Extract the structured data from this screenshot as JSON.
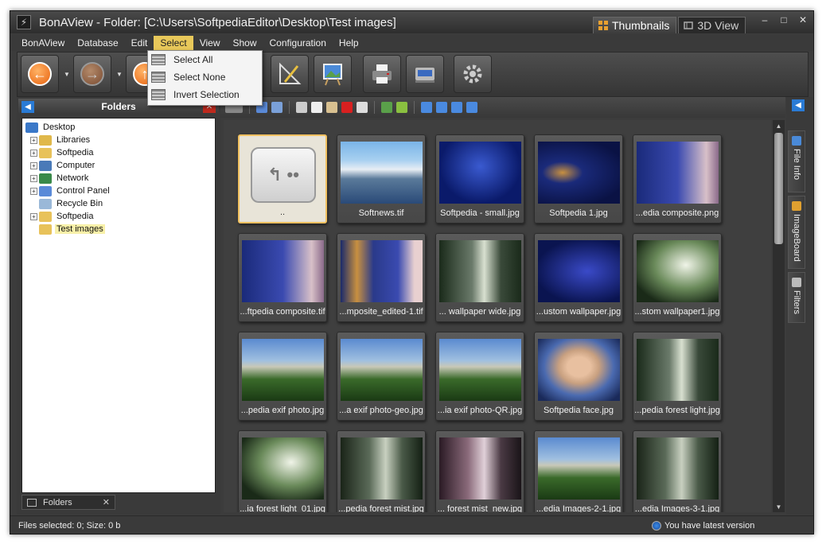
{
  "window": {
    "title": "BonAView - Folder: [C:\\Users\\SoftpediaEditor\\Desktop\\Test images]",
    "view_tabs": [
      {
        "label": "Thumbnails",
        "icon": "grid-icon",
        "active": true
      },
      {
        "label": "3D View",
        "icon": "3d-view-icon",
        "active": false
      }
    ],
    "controls": {
      "minimize": "–",
      "maximize": "□",
      "close": "✕"
    }
  },
  "menu": {
    "items": [
      "BonAView",
      "Database",
      "Edit",
      "Select",
      "View",
      "Show",
      "Configuration",
      "Help"
    ],
    "open_index": 3
  },
  "select_menu": {
    "items": [
      "Select All",
      "Select None",
      "Invert Selection"
    ]
  },
  "folders_panel": {
    "title": "Folders",
    "tree": [
      {
        "label": "Desktop",
        "icon": "desktop-icon",
        "color": "#3a78c8",
        "expander": "",
        "indent": 0
      },
      {
        "label": "Libraries",
        "icon": "libraries-icon",
        "color": "#e0b84a",
        "expander": "+",
        "indent": 1
      },
      {
        "label": "Softpedia",
        "icon": "folder-icon",
        "color": "#e8c25a",
        "expander": "+",
        "indent": 1
      },
      {
        "label": "Computer",
        "icon": "computer-icon",
        "color": "#4a7ab8",
        "expander": "+",
        "indent": 1
      },
      {
        "label": "Network",
        "icon": "network-icon",
        "color": "#3a8a4a",
        "expander": "+",
        "indent": 1
      },
      {
        "label": "Control Panel",
        "icon": "control-panel-icon",
        "color": "#5a8ad8",
        "expander": "+",
        "indent": 1
      },
      {
        "label": "Recycle Bin",
        "icon": "recycle-bin-icon",
        "color": "#9ab8d8",
        "expander": "",
        "indent": 1
      },
      {
        "label": "Softpedia",
        "icon": "folder-icon",
        "color": "#e8c25a",
        "expander": "+",
        "indent": 1
      },
      {
        "label": "Test images",
        "icon": "folder-icon",
        "color": "#e8c25a",
        "expander": "",
        "indent": 1,
        "selected": true
      }
    ],
    "bottom_tab": "Folders"
  },
  "thumbnails": [
    {
      "label": "..",
      "kind": "up"
    },
    {
      "label": "Softnews.tif",
      "kind": "coast"
    },
    {
      "label": "Softpedia  - small.jpg",
      "kind": "softpedia-text"
    },
    {
      "label": "Softpedia 1.jpg",
      "kind": "softpedia-swirl"
    },
    {
      "label": "...edia composite.png",
      "kind": "composite"
    },
    {
      "label": "...ftpedia composite.tif",
      "kind": "composite"
    },
    {
      "label": "...mposite_edited-1.tif",
      "kind": "composite-wide"
    },
    {
      "label": "... wallpaper wide.jpg",
      "kind": "forest"
    },
    {
      "label": "...ustom wallpaper.jpg",
      "kind": "blue-abstract"
    },
    {
      "label": "...stom wallpaper1.jpg",
      "kind": "forest-light"
    },
    {
      "label": "...pedia exif photo.jpg",
      "kind": "mountain"
    },
    {
      "label": "...a exif photo-geo.jpg",
      "kind": "mountain"
    },
    {
      "label": "...ia exif photo-QR.jpg",
      "kind": "mountain"
    },
    {
      "label": "Softpedia face.jpg",
      "kind": "face"
    },
    {
      "label": "...pedia forest light.jpg",
      "kind": "forest"
    },
    {
      "label": "...ia forest light_01.jpg",
      "kind": "forest-light"
    },
    {
      "label": "...pedia forest mist.jpg",
      "kind": "forest-mist"
    },
    {
      "label": "... forest mist_new.jpg",
      "kind": "forest-pink"
    },
    {
      "label": "...edia Images-2-1.jpg",
      "kind": "mountain"
    },
    {
      "label": "...edia Images-3-1.jpg",
      "kind": "forest-mist"
    }
  ],
  "side_tabs": [
    "File Info",
    "ImageBoard",
    "Filters"
  ],
  "status": {
    "left": "Files selected: 0; Size: 0 b",
    "right": "You have latest version"
  },
  "colors": {
    "accent_menu": "#e8c85a",
    "panel": "#3c3c3c",
    "selection": "#f8f0a8",
    "collapse_button": "#2a7bd5",
    "close_button": "#c02a1e"
  }
}
